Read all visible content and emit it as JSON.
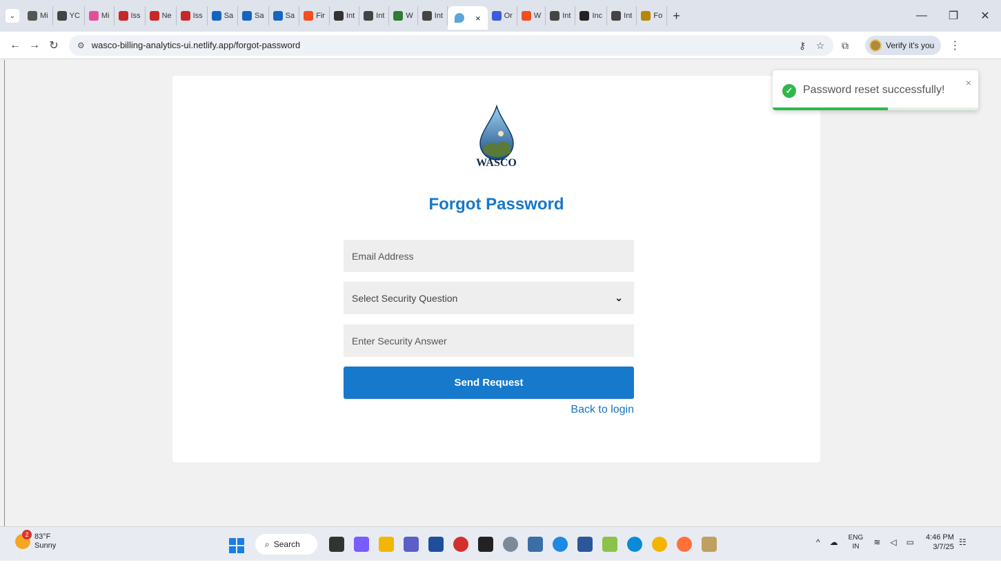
{
  "browser": {
    "tabs": [
      {
        "label": "Mi",
        "fav_color": "#555555"
      },
      {
        "label": "YC",
        "fav_color": "#444444"
      },
      {
        "label": "Mi",
        "fav_color": "#e0509a"
      },
      {
        "label": "Iss",
        "fav_color": "#c62828"
      },
      {
        "label": "Ne",
        "fav_color": "#c62828"
      },
      {
        "label": "Iss",
        "fav_color": "#c62828"
      },
      {
        "label": "Sa",
        "fav_color": "#1565c0"
      },
      {
        "label": "Sa",
        "fav_color": "#1565c0"
      },
      {
        "label": "Sa",
        "fav_color": "#1565c0"
      },
      {
        "label": "Fir",
        "fav_color": "#f24e1e"
      },
      {
        "label": "Int",
        "fav_color": "#333333"
      },
      {
        "label": "Int",
        "fav_color": "#444444"
      },
      {
        "label": "W",
        "fav_color": "#2e7d32"
      },
      {
        "label": "Int",
        "fav_color": "#444444"
      }
    ],
    "active_tab_close": "×",
    "tabs_after": [
      {
        "label": "Or",
        "fav_color": "#3b5bdb"
      },
      {
        "label": "W",
        "fav_color": "#f24e1e"
      },
      {
        "label": "Int",
        "fav_color": "#444444"
      },
      {
        "label": "Inc",
        "fav_color": "#222222"
      },
      {
        "label": "Int",
        "fav_color": "#444444"
      },
      {
        "label": "Fo",
        "fav_color": "#b8860b"
      }
    ],
    "new_tab": "+",
    "url": "wasco-billing-analytics-ui.netlify.app/forgot-password",
    "verify_label": "Verify it's you"
  },
  "page": {
    "logo_text": "WASCO",
    "title": "Forgot Password",
    "email_placeholder": "Email Address",
    "security_question_placeholder": "Select Security Question",
    "security_answer_placeholder": "Enter Security Answer",
    "send_label": "Send Request",
    "back_label": "Back to login"
  },
  "toast": {
    "message": "Password reset successfully!",
    "close": "×",
    "progress": 0.56,
    "color": "#2eb84a"
  },
  "taskbar": {
    "weather_temp": "83°F",
    "weather_desc": "Sunny",
    "weather_badge": "2",
    "search_label": "Search",
    "lang_top": "ENG",
    "lang_bottom": "IN",
    "time": "4:46 PM",
    "date": "3/7/25"
  },
  "colors": {
    "accent": "#1677c8",
    "button": "#1679cc"
  }
}
